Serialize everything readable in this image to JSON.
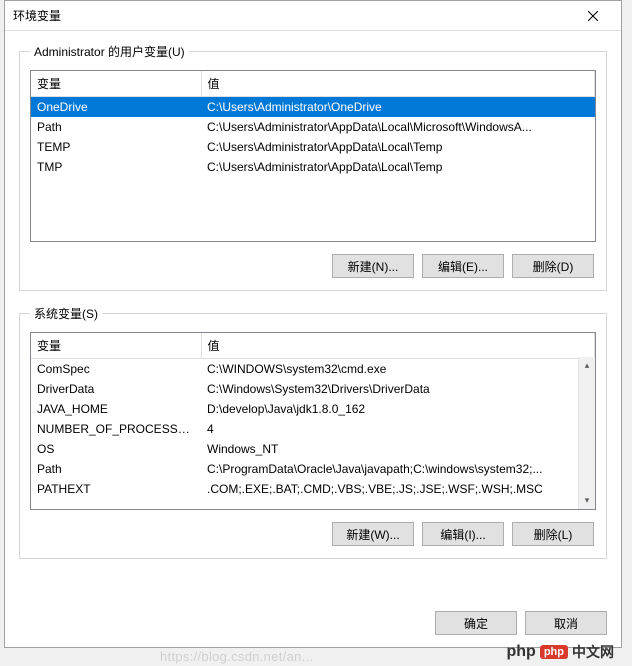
{
  "dialog": {
    "title": "环境变量",
    "close_tooltip": "Close"
  },
  "user_group": {
    "legend": "Administrator 的用户变量(U)",
    "columns": {
      "name": "变量",
      "value": "值"
    },
    "rows": [
      {
        "name": "OneDrive",
        "value": "C:\\Users\\Administrator\\OneDrive",
        "selected": true
      },
      {
        "name": "Path",
        "value": "C:\\Users\\Administrator\\AppData\\Local\\Microsoft\\WindowsA...",
        "selected": false
      },
      {
        "name": "TEMP",
        "value": "C:\\Users\\Administrator\\AppData\\Local\\Temp",
        "selected": false
      },
      {
        "name": "TMP",
        "value": "C:\\Users\\Administrator\\AppData\\Local\\Temp",
        "selected": false
      }
    ],
    "buttons": {
      "new": "新建(N)...",
      "edit": "编辑(E)...",
      "delete": "删除(D)"
    }
  },
  "system_group": {
    "legend": "系统变量(S)",
    "columns": {
      "name": "变量",
      "value": "值"
    },
    "rows": [
      {
        "name": "ComSpec",
        "value": "C:\\WINDOWS\\system32\\cmd.exe"
      },
      {
        "name": "DriverData",
        "value": "C:\\Windows\\System32\\Drivers\\DriverData"
      },
      {
        "name": "JAVA_HOME",
        "value": "D:\\develop\\Java\\jdk1.8.0_162"
      },
      {
        "name": "NUMBER_OF_PROCESSORS",
        "value": "4"
      },
      {
        "name": "OS",
        "value": "Windows_NT"
      },
      {
        "name": "Path",
        "value": "C:\\ProgramData\\Oracle\\Java\\javapath;C:\\windows\\system32;..."
      },
      {
        "name": "PATHEXT",
        "value": ".COM;.EXE;.BAT;.CMD;.VBS;.VBE;.JS;.JSE;.WSF;.WSH;.MSC"
      }
    ],
    "buttons": {
      "new": "新建(W)...",
      "edit": "编辑(I)...",
      "delete": "删除(L)"
    }
  },
  "footer": {
    "ok": "确定",
    "cancel": "取消"
  },
  "watermark": {
    "url": "https://blog.csdn.net/an...",
    "brand_php": "php",
    "brand_cn": "中文网"
  }
}
